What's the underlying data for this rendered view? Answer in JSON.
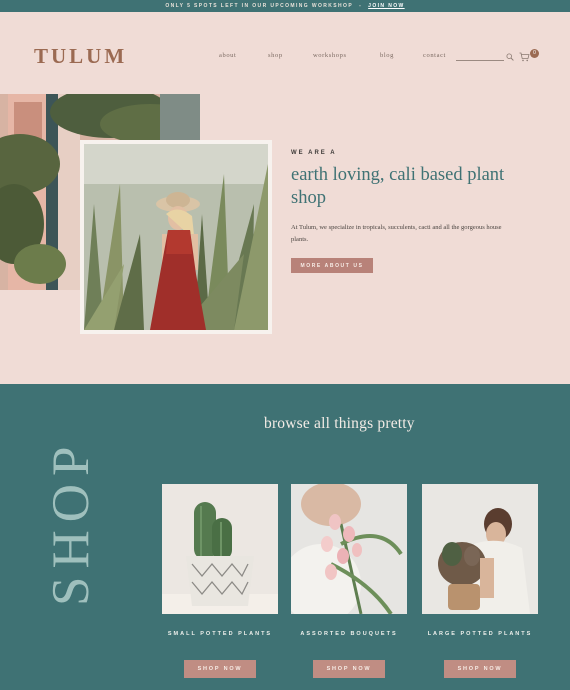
{
  "announcement": {
    "text": "ONLY 5 SPOTS LEFT IN OUR UPCOMING WORKSHOP",
    "separator": "-",
    "link": "JOIN NOW"
  },
  "brand": {
    "logo": "TULUM"
  },
  "nav": {
    "items": [
      {
        "label": "about"
      },
      {
        "label": "shop"
      },
      {
        "label": "workshops"
      },
      {
        "label": "blog"
      },
      {
        "label": "contact"
      }
    ],
    "cart_count": "0"
  },
  "hero": {
    "eyebrow": "WE ARE A",
    "title": "earth loving, cali based plant shop",
    "body": "At Tulum, we specialize in tropicals, succulents, cacti and all the gorgeous house plants.",
    "button": "MORE ABOUT US"
  },
  "shop": {
    "vertical_label": "SHOP",
    "title": "browse all things pretty",
    "products": [
      {
        "label": "SMALL POTTED PLANTS",
        "button": "SHOP NOW"
      },
      {
        "label": "ASSORTED BOUQUETS",
        "button": "SHOP NOW"
      },
      {
        "label": "LARGE POTTED PLANTS",
        "button": "SHOP NOW"
      }
    ]
  },
  "colors": {
    "teal": "#3f7274",
    "blush": "#f0dcd6",
    "rose_button": "#b88279",
    "logo_brown": "#9b6a52"
  },
  "icons": [
    "search-icon",
    "cart-icon"
  ]
}
